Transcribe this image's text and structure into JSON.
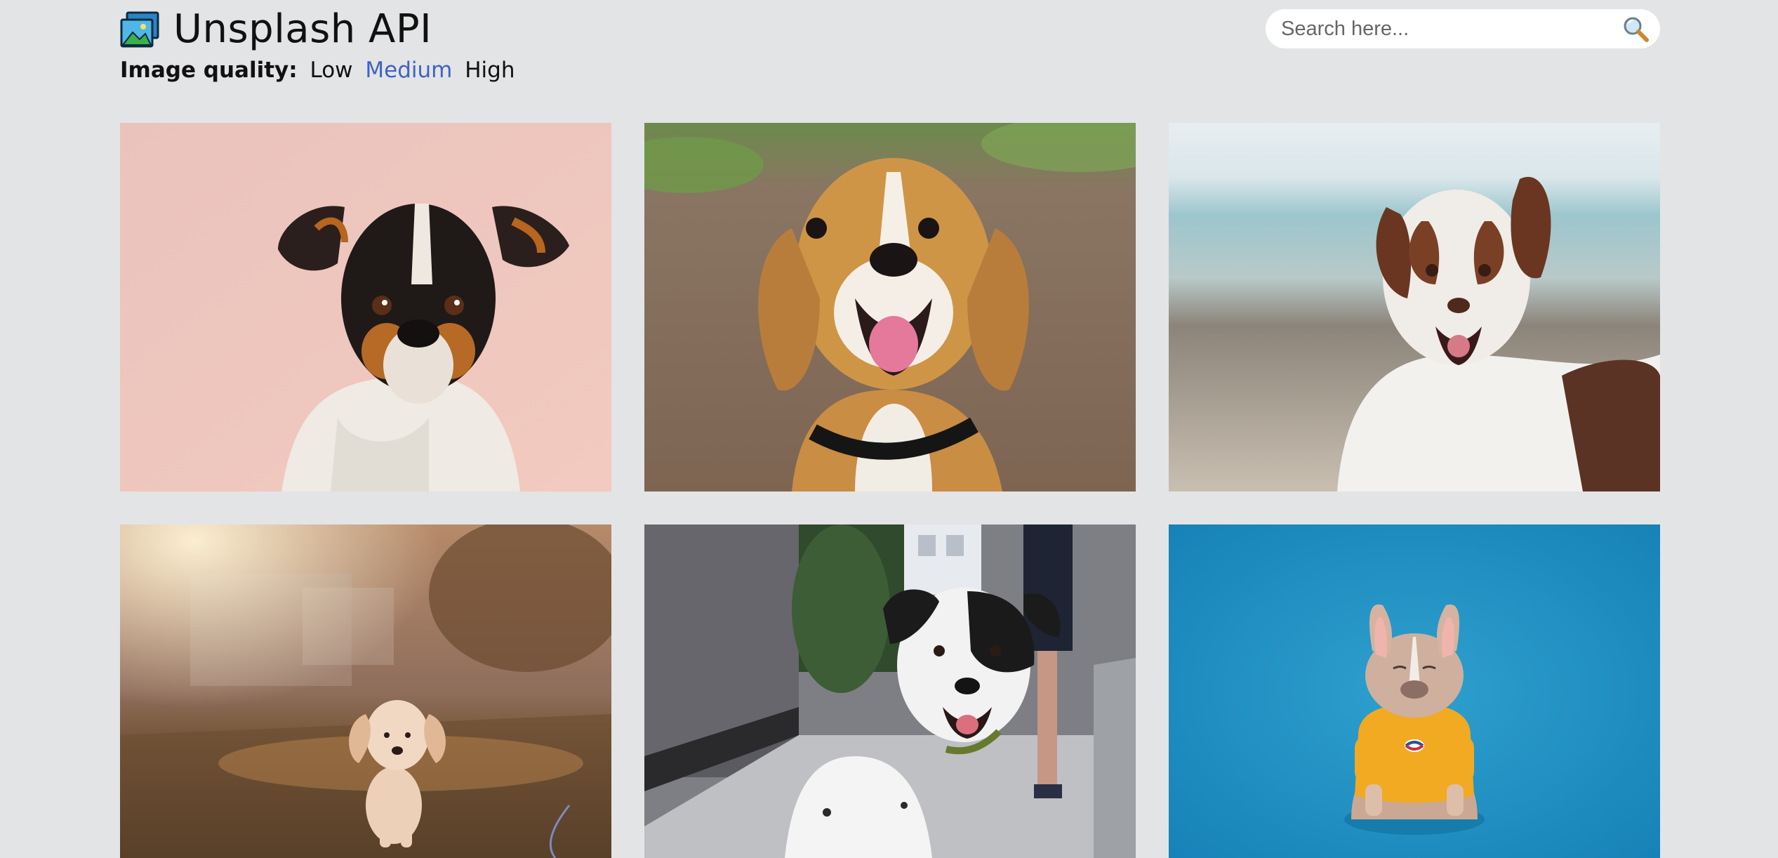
{
  "app": {
    "title": "Unsplash API",
    "logo_icon": "image-gallery-icon"
  },
  "quality": {
    "label": "Image quality:",
    "options": [
      {
        "label": "Low",
        "active": false
      },
      {
        "label": "Medium",
        "active": true
      },
      {
        "label": "High",
        "active": false
      }
    ],
    "active_color": "#3f63c0"
  },
  "search": {
    "placeholder": "Search here...",
    "value": "",
    "icon": "search-icon"
  },
  "photos": [
    {
      "subject": "dog-portrait-pink-background"
    },
    {
      "subject": "beagle-smiling"
    },
    {
      "subject": "border-collie-beach"
    },
    {
      "subject": "golden-puppy-running"
    },
    {
      "subject": "black-white-dog-street"
    },
    {
      "subject": "french-bulldog-blue-background"
    }
  ],
  "colors": {
    "background": "#e3e4e6",
    "accent": "#3f63c0"
  }
}
